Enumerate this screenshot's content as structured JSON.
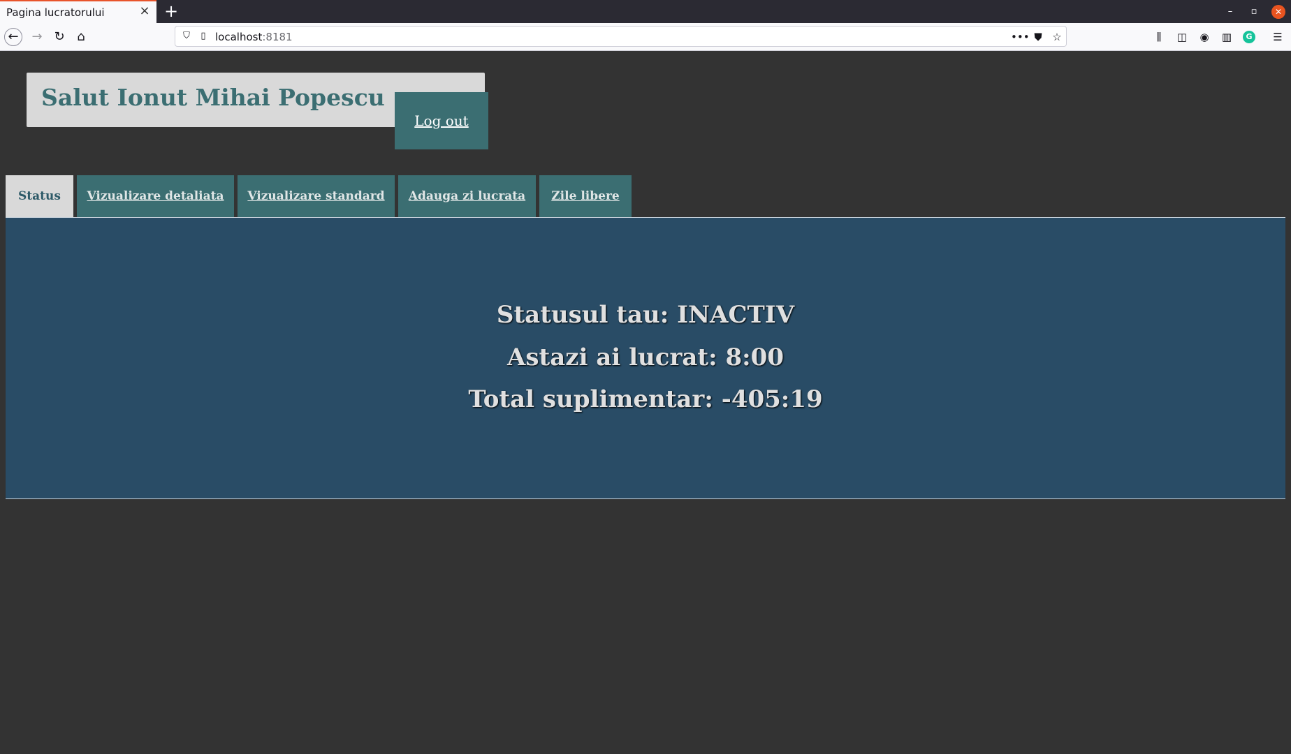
{
  "browser": {
    "tab_title": "Pagina lucratorului",
    "tab_close_icon": "close-icon",
    "new_tab_label": "+",
    "url_host": "localhost",
    "url_port": ":8181"
  },
  "header": {
    "greeting": "Salut Ionut Mihai Popescu",
    "logout_label": "Log out"
  },
  "tabs": [
    {
      "label": "Status",
      "active": true
    },
    {
      "label": "Vizualizare detaliata",
      "active": false
    },
    {
      "label": "Vizualizare standard",
      "active": false
    },
    {
      "label": "Adauga zi lucrata",
      "active": false
    },
    {
      "label": "Zile libere",
      "active": false
    }
  ],
  "status": {
    "line1": "Statusul tau: INACTIV",
    "line2": "Astazi ai lucrat: 8:00",
    "line3": "Total suplimentar: -405:19"
  },
  "colors": {
    "background": "#333333",
    "accent_teal": "#3b6e72",
    "panel_blue": "#294c66",
    "greeting_box": "#d9d9d9"
  }
}
